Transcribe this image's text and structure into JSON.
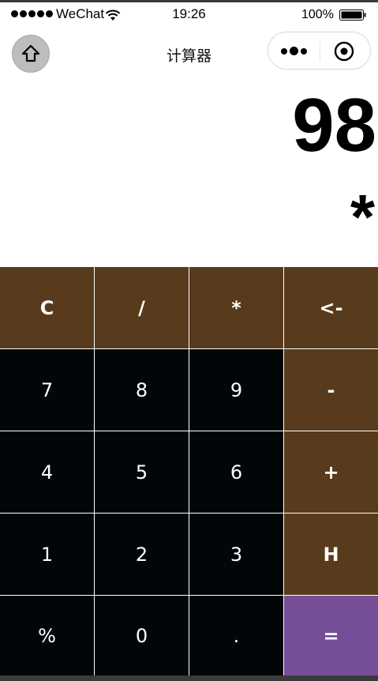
{
  "status_bar": {
    "carrier": "WeChat",
    "time": "19:26",
    "battery": "100%"
  },
  "nav": {
    "title": "计算器"
  },
  "display": {
    "value": "98",
    "operator": "*"
  },
  "keys": [
    {
      "label": "C",
      "type": "func"
    },
    {
      "label": "/",
      "type": "func"
    },
    {
      "label": "*",
      "type": "func"
    },
    {
      "label": "<-",
      "type": "func"
    },
    {
      "label": "7",
      "type": "num"
    },
    {
      "label": "8",
      "type": "num"
    },
    {
      "label": "9",
      "type": "num"
    },
    {
      "label": "-",
      "type": "func"
    },
    {
      "label": "4",
      "type": "num"
    },
    {
      "label": "5",
      "type": "num"
    },
    {
      "label": "6",
      "type": "num"
    },
    {
      "label": "+",
      "type": "func"
    },
    {
      "label": "1",
      "type": "num"
    },
    {
      "label": "2",
      "type": "num"
    },
    {
      "label": "3",
      "type": "num"
    },
    {
      "label": "H",
      "type": "func"
    },
    {
      "label": "%",
      "type": "num"
    },
    {
      "label": "0",
      "type": "num"
    },
    {
      "label": ".",
      "type": "num"
    },
    {
      "label": "=",
      "type": "eq"
    }
  ],
  "colors": {
    "function_key": "#583b1c",
    "number_key": "#030608",
    "equals_key": "#754e98",
    "key_text": "#ffffff"
  },
  "icons": {
    "home": "home-icon",
    "more": "more-dots-icon",
    "close": "target-close-icon",
    "wifi": "wifi-icon",
    "battery": "battery-icon"
  }
}
